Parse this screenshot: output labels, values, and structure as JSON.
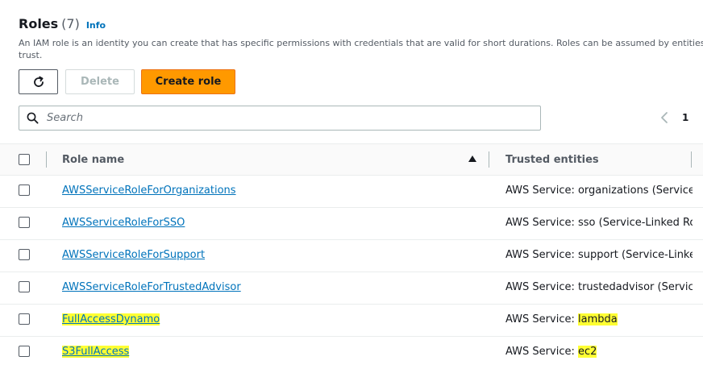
{
  "header": {
    "title": "Roles",
    "count": "(7)",
    "info_link": "Info",
    "description_line1": "An IAM role is an identity you can create that has specific permissions with credentials that are valid for short durations. Roles can be assumed by entities tha",
    "description_line2": "trust."
  },
  "toolbar": {
    "refresh_icon": "refresh-icon",
    "delete_label": "Delete",
    "create_label": "Create role"
  },
  "search": {
    "placeholder": "Search",
    "value": ""
  },
  "pagination": {
    "prev_icon": "chevron-left-icon",
    "current_page": "1"
  },
  "table": {
    "columns": [
      "Role name",
      "Trusted entities"
    ],
    "sort": "ascending",
    "rows": [
      {
        "role": "AWSServiceRoleForOrganizations",
        "trusted_prefix": "AWS Service: organizations ",
        "trusted_suffix": "(Service-"
      },
      {
        "role": "AWSServiceRoleForSSO",
        "trusted_prefix": "AWS Service: sso ",
        "trusted_suffix": "(Service-Linked Rol"
      },
      {
        "role": "AWSServiceRoleForSupport",
        "trusted_prefix": "AWS Service: support ",
        "trusted_suffix": "(Service-Linkec"
      },
      {
        "role": "AWSServiceRoleForTrustedAdvisor",
        "trusted_prefix": "AWS Service: trustedadvisor ",
        "trusted_suffix": "(Service"
      },
      {
        "role": "FullAccessDynamo",
        "trusted_prefix": "AWS Service: ",
        "trusted_suffix": "lambda"
      },
      {
        "role": "S3FullAccess",
        "trusted_prefix": "AWS Service: ",
        "trusted_suffix": "ec2"
      }
    ]
  },
  "colors": {
    "link": "#0073bb",
    "primary_button": "#ff9900",
    "highlight": "#ffff33"
  }
}
